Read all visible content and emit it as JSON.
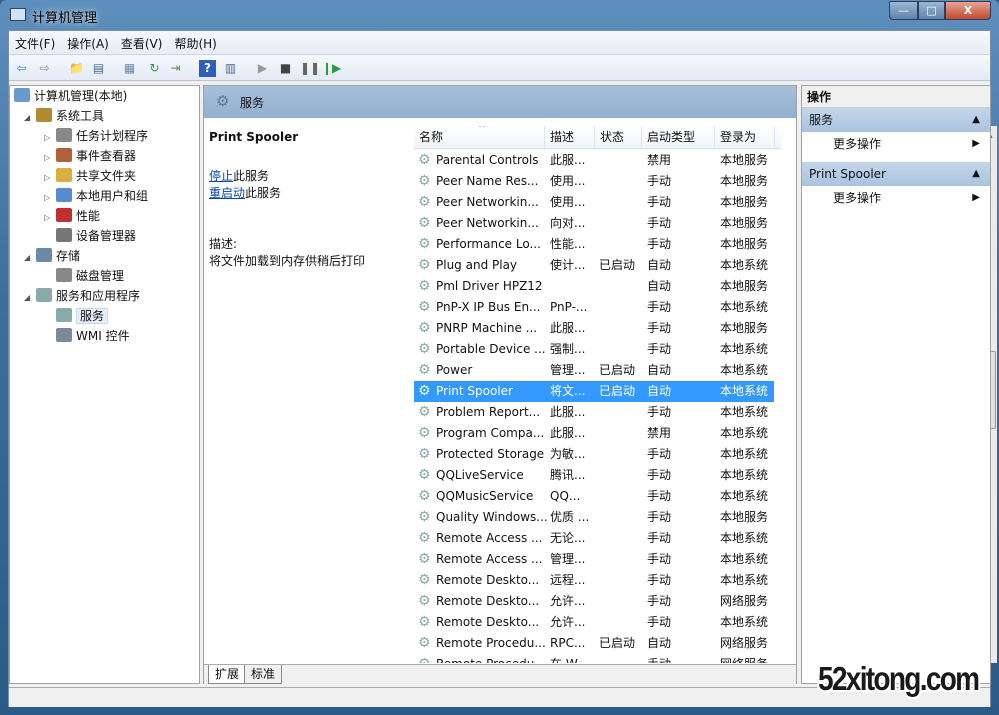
{
  "window": {
    "title": "计算机管理",
    "minimize": "—",
    "maximize": "□",
    "close": "X"
  },
  "menu": [
    "文件(F)",
    "操作(A)",
    "查看(V)",
    "帮助(H)"
  ],
  "toolbar": [
    "back-icon",
    "forward-icon",
    "up-folder-icon",
    "show-hide-tree-icon",
    "properties-icon",
    "refresh-icon",
    "export-icon",
    "help-icon",
    "show-hide-action-icon",
    "start-icon",
    "stop-icon",
    "pause-icon",
    "resume-icon"
  ],
  "tree": [
    {
      "label": "计算机管理(本地)",
      "level": 0,
      "exp": ""
    },
    {
      "label": "系统工具",
      "level": 1,
      "exp": "◢"
    },
    {
      "label": "任务计划程序",
      "level": 2,
      "exp": "▷"
    },
    {
      "label": "事件查看器",
      "level": 2,
      "exp": "▷"
    },
    {
      "label": "共享文件夹",
      "level": 2,
      "exp": "▷"
    },
    {
      "label": "本地用户和组",
      "level": 2,
      "exp": "▷"
    },
    {
      "label": "性能",
      "level": 2,
      "exp": "▷"
    },
    {
      "label": "设备管理器",
      "level": 2,
      "exp": ""
    },
    {
      "label": "存储",
      "level": 1,
      "exp": "◢"
    },
    {
      "label": "磁盘管理",
      "level": 2,
      "exp": ""
    },
    {
      "label": "服务和应用程序",
      "level": 1,
      "exp": "◢"
    },
    {
      "label": "服务",
      "level": 2,
      "exp": "",
      "selected": true
    },
    {
      "label": "WMI 控件",
      "level": 2,
      "exp": ""
    }
  ],
  "center": {
    "header": "服务",
    "detail": {
      "name": "Print Spooler",
      "stop_link": "停止",
      "stop_suffix": "此服务",
      "restart_link": "重启动",
      "restart_suffix": "此服务",
      "desc_label": "描述:",
      "desc_text": "将文件加载到内存供稍后打印"
    },
    "columns": [
      "名称",
      "描述",
      "状态",
      "启动类型",
      "登录为"
    ],
    "rows": [
      [
        "Parental Controls",
        "此服...",
        "",
        "禁用",
        "本地服务"
      ],
      [
        "Peer Name Res...",
        "使用...",
        "",
        "手动",
        "本地服务"
      ],
      [
        "Peer Networkin...",
        "使用...",
        "",
        "手动",
        "本地服务"
      ],
      [
        "Peer Networkin...",
        "向对...",
        "",
        "手动",
        "本地服务"
      ],
      [
        "Performance Lo...",
        "性能...",
        "",
        "手动",
        "本地服务"
      ],
      [
        "Plug and Play",
        "使计...",
        "已启动",
        "自动",
        "本地系统"
      ],
      [
        "Pml Driver HPZ12",
        "",
        "",
        "自动",
        "本地服务"
      ],
      [
        "PnP-X IP Bus En...",
        "PnP-...",
        "",
        "手动",
        "本地系统"
      ],
      [
        "PNRP Machine ...",
        "此服...",
        "",
        "手动",
        "本地服务"
      ],
      [
        "Portable Device ...",
        "强制...",
        "",
        "手动",
        "本地系统"
      ],
      [
        "Power",
        "管理...",
        "已启动",
        "自动",
        "本地系统"
      ],
      [
        "Print Spooler",
        "将文...",
        "已启动",
        "自动",
        "本地系统"
      ],
      [
        "Problem Report...",
        "此服...",
        "",
        "手动",
        "本地系统"
      ],
      [
        "Program Compa...",
        "此服...",
        "",
        "禁用",
        "本地系统"
      ],
      [
        "Protected Storage",
        "为敏...",
        "",
        "手动",
        "本地系统"
      ],
      [
        "QQLiveService",
        "腾讯...",
        "",
        "手动",
        "本地系统"
      ],
      [
        "QQMusicService",
        "QQ...",
        "",
        "手动",
        "本地系统"
      ],
      [
        "Quality Windows...",
        "优质 ...",
        "",
        "手动",
        "本地服务"
      ],
      [
        "Remote Access ...",
        "无论...",
        "",
        "手动",
        "本地系统"
      ],
      [
        "Remote Access ...",
        "管理...",
        "",
        "手动",
        "本地系统"
      ],
      [
        "Remote Deskto...",
        "远程...",
        "",
        "手动",
        "本地系统"
      ],
      [
        "Remote Deskto...",
        "允许...",
        "",
        "手动",
        "网络服务"
      ],
      [
        "Remote Deskto...",
        "允许...",
        "",
        "手动",
        "本地系统"
      ],
      [
        "Remote Procedu...",
        "RPC...",
        "已启动",
        "自动",
        "网络服务"
      ],
      [
        "Remote Procedu...",
        "在 W...",
        "",
        "手动",
        "网络服务"
      ]
    ],
    "selected_row": 11,
    "tabs": [
      "扩展",
      "标准"
    ]
  },
  "actions": {
    "title": "操作",
    "sections": [
      {
        "label": "服务",
        "item": "更多操作"
      },
      {
        "label": "Print Spooler",
        "item": "更多操作"
      }
    ]
  },
  "watermark": "52xitong.com",
  "colors": {
    "selection": "#3399ff",
    "header": "#9fb8d6",
    "link": "#0645ad"
  }
}
